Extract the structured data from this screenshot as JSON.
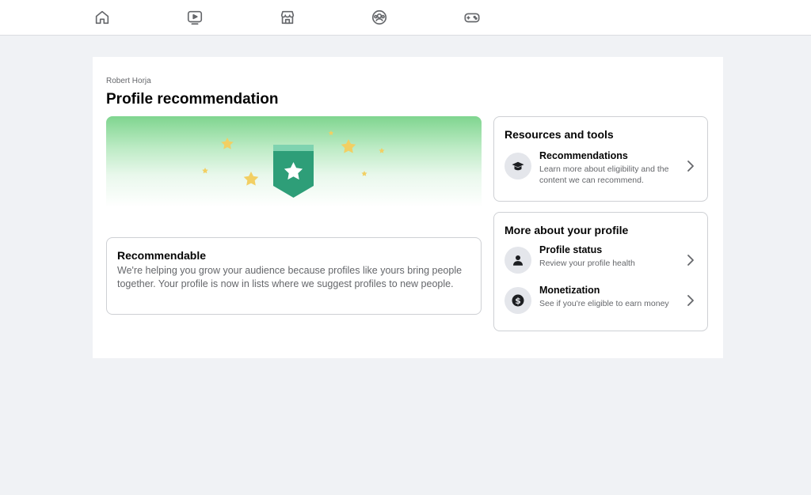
{
  "nav": {
    "items": [
      {
        "icon": "home-icon"
      },
      {
        "icon": "video-icon"
      },
      {
        "icon": "marketplace-icon"
      },
      {
        "icon": "groups-icon"
      },
      {
        "icon": "gaming-icon"
      }
    ]
  },
  "page": {
    "owner_name": "Robert Horja",
    "title": "Profile recommendation"
  },
  "status_card": {
    "title": "Recommendable",
    "description": "We're helping you grow your audience because profiles like yours bring people together. Your profile is now in lists where we suggest profiles to new people."
  },
  "resources": {
    "heading": "Resources and tools",
    "items": [
      {
        "title": "Recommendations",
        "subtitle": "Learn more about eligibility and the content we can recommend.",
        "icon": "graduation-cap-icon"
      }
    ]
  },
  "more_profile": {
    "heading": "More about your profile",
    "items": [
      {
        "title": "Profile status",
        "subtitle": "Review your profile health",
        "icon": "person-icon"
      },
      {
        "title": "Monetization",
        "subtitle": "See if you're eligible to earn money",
        "icon": "dollar-icon"
      }
    ]
  },
  "colors": {
    "accent_green": "#35a272",
    "star_yellow": "#f2cf63",
    "background": "#f0f2f5"
  }
}
